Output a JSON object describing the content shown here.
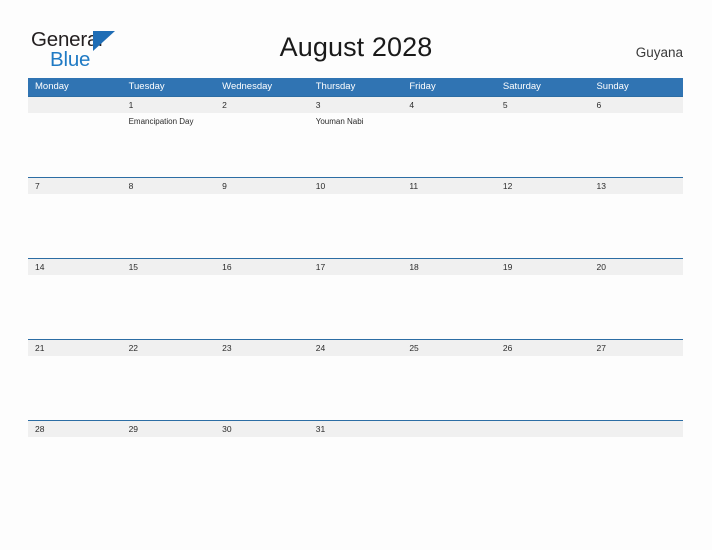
{
  "brand": {
    "name_part1": "General",
    "name_part2": "Blue",
    "flag_icon": "blue-triangle-flag",
    "colors": {
      "dark": "#231f20",
      "blue": "#1f7ac4",
      "flag": "#1f6db5"
    }
  },
  "header": {
    "title": "August 2028",
    "country": "Guyana"
  },
  "calendar": {
    "header_bg": "#3074b3",
    "date_strip_bg": "#f0f0f0",
    "row_divider": "#2c6da4",
    "day_names": [
      "Monday",
      "Tuesday",
      "Wednesday",
      "Thursday",
      "Friday",
      "Saturday",
      "Sunday"
    ],
    "weeks": [
      {
        "dates": [
          "",
          "1",
          "2",
          "3",
          "4",
          "5",
          "6"
        ],
        "events": [
          "",
          "Emancipation Day",
          "",
          "Youman Nabi",
          "",
          "",
          ""
        ]
      },
      {
        "dates": [
          "7",
          "8",
          "9",
          "10",
          "11",
          "12",
          "13"
        ],
        "events": [
          "",
          "",
          "",
          "",
          "",
          "",
          ""
        ]
      },
      {
        "dates": [
          "14",
          "15",
          "16",
          "17",
          "18",
          "19",
          "20"
        ],
        "events": [
          "",
          "",
          "",
          "",
          "",
          "",
          ""
        ]
      },
      {
        "dates": [
          "21",
          "22",
          "23",
          "24",
          "25",
          "26",
          "27"
        ],
        "events": [
          "",
          "",
          "",
          "",
          "",
          "",
          ""
        ]
      },
      {
        "dates": [
          "28",
          "29",
          "30",
          "31",
          "",
          "",
          ""
        ],
        "events": [
          "",
          "",
          "",
          "",
          "",
          "",
          ""
        ]
      }
    ]
  }
}
